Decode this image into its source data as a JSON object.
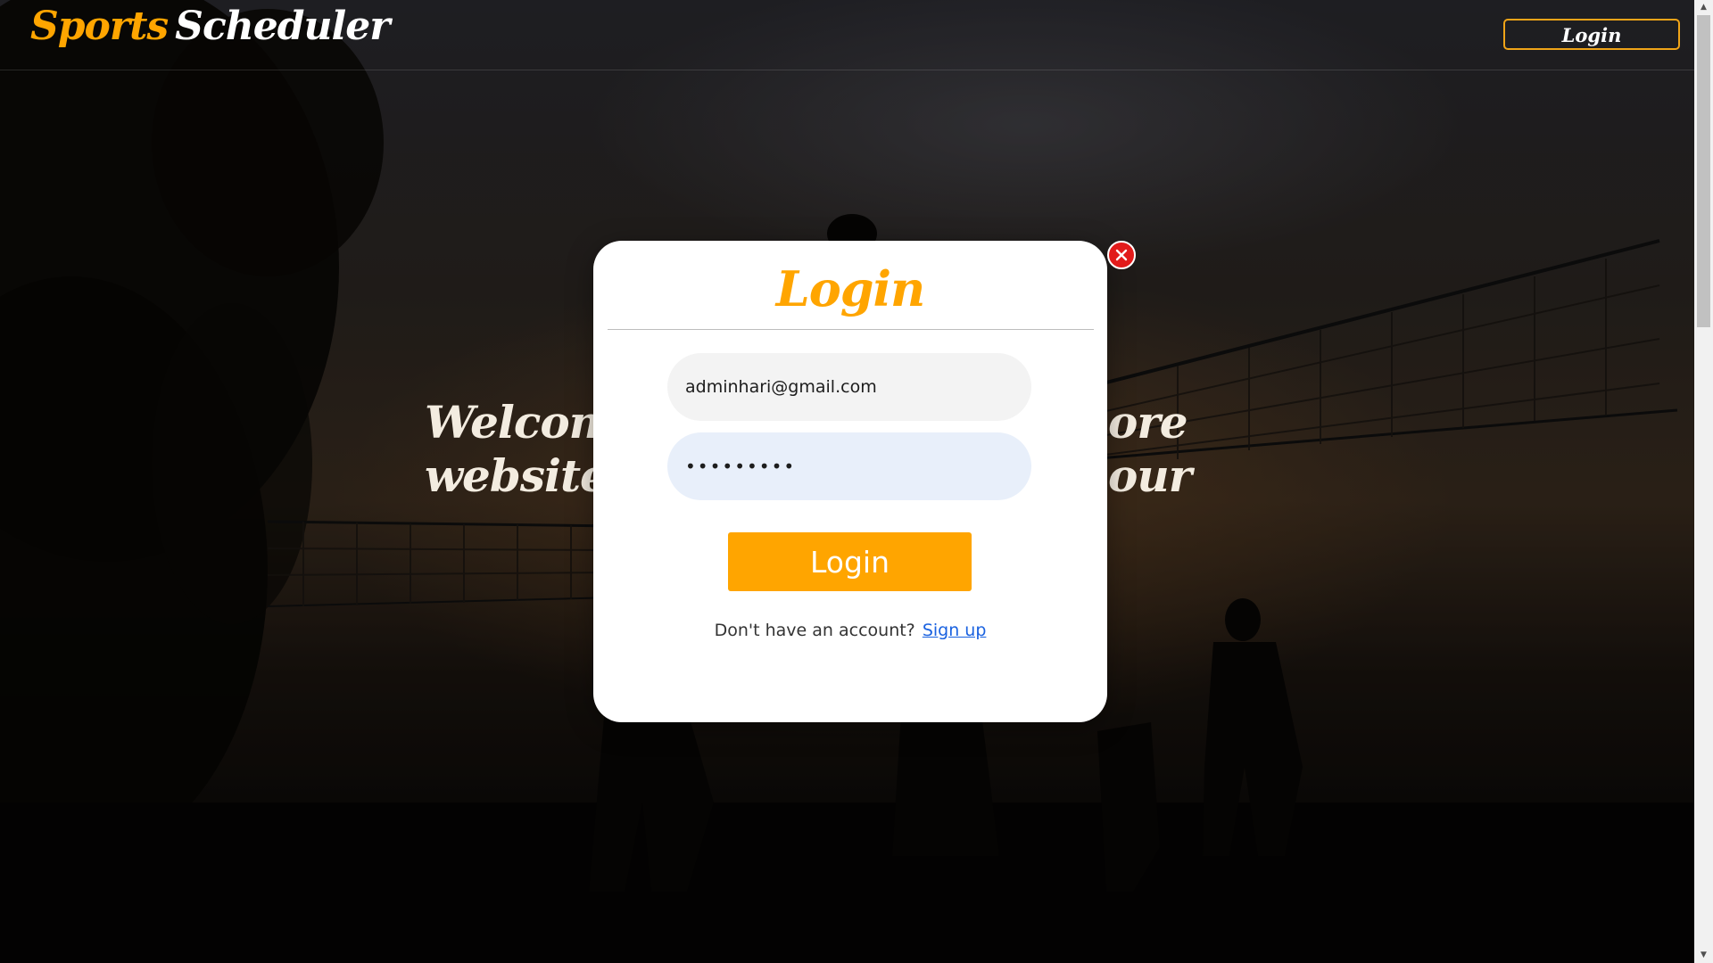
{
  "navbar": {
    "brand_accent": "Sports",
    "brand_rest": "Scheduler",
    "login_button": "Login"
  },
  "hero": {
    "heading_visible_fragments": [
      "Welcome",
      "ore our",
      "website t"
    ]
  },
  "login_modal": {
    "title": "Login",
    "email_value": "adminhari@gmail.com",
    "password_masked": "•••••••••",
    "submit_label": "Login",
    "signup_prompt": "Don't have an account?",
    "signup_link": "Sign up",
    "close_icon": "close-x-icon"
  },
  "colors": {
    "accent": "#ffa500",
    "close_red": "#e21b1b",
    "link_blue": "#1a62e0",
    "password_bg": "#e8effa",
    "email_bg": "#f3f3f3"
  }
}
